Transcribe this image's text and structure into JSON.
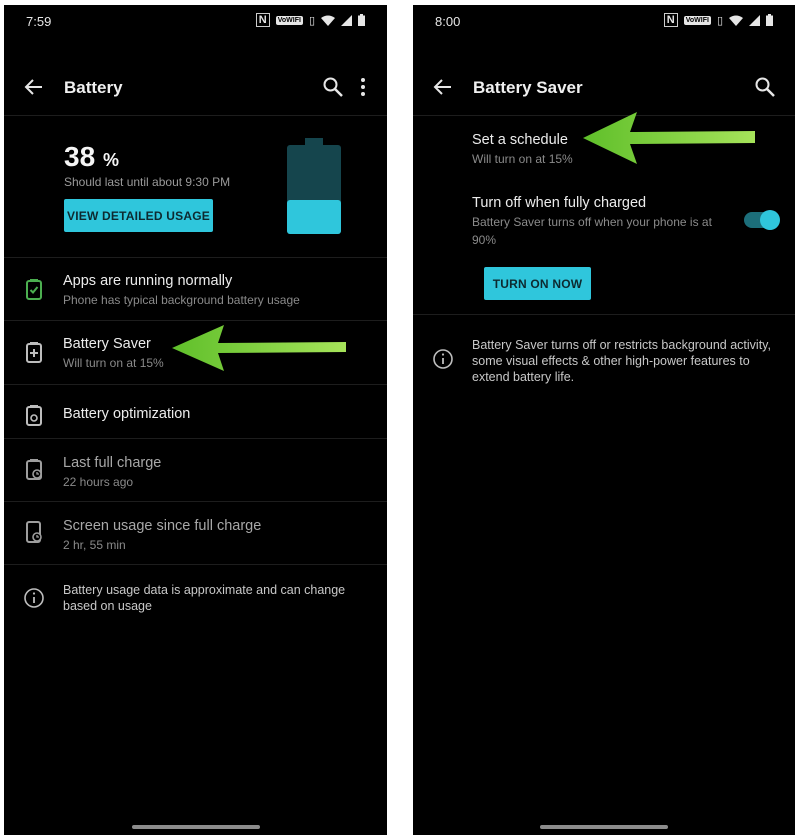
{
  "left": {
    "status": {
      "time": "7:59",
      "nfc": "N",
      "vowifi": "VoWIFI"
    },
    "toolbar": {
      "title": "Battery"
    },
    "battery": {
      "percent": "38",
      "unit": "%",
      "estimate": "Should last until about 9:30 PM",
      "level_fraction": 0.38
    },
    "detail_button": "VIEW DETAILED USAGE",
    "items": [
      {
        "title": "Apps are running normally",
        "subtitle": "Phone has typical background battery usage"
      },
      {
        "title": "Battery Saver",
        "subtitle": "Will turn on at 15%"
      },
      {
        "title": "Battery optimization"
      },
      {
        "title": "Last full charge",
        "subtitle": "22 hours ago"
      },
      {
        "title": "Screen usage since full charge",
        "subtitle": "2 hr, 55 min"
      }
    ],
    "info": "Battery usage data is approximate and can change based on usage"
  },
  "right": {
    "status": {
      "time": "8:00",
      "nfc": "N",
      "vowifi": "VoWIFI"
    },
    "toolbar": {
      "title": "Battery Saver"
    },
    "schedule": {
      "title": "Set a schedule",
      "subtitle": "Will turn on at 15%"
    },
    "fully_charged": {
      "title": "Turn off when fully charged",
      "subtitle": "Battery Saver turns off when your phone is at 90%",
      "enabled": true
    },
    "turn_on_button": "TURN ON NOW",
    "info": "Battery Saver turns off or restricts background activity, some visual effects & other high-power features to extend battery life."
  },
  "colors": {
    "accent": "#2fc6dc",
    "arrow": "#7dd12c",
    "background": "#000000",
    "ok_icon": "#4caf50"
  }
}
